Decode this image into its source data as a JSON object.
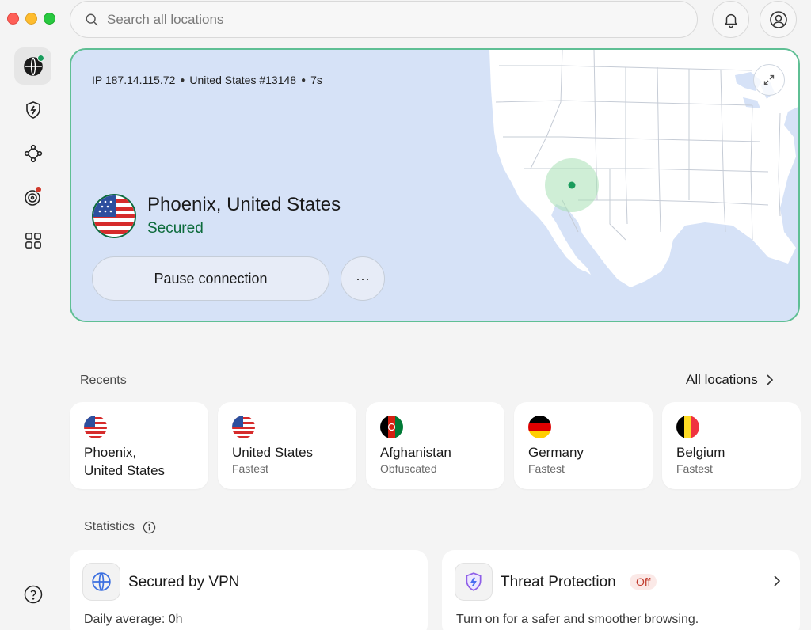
{
  "window": {
    "search_placeholder": "Search all locations"
  },
  "connection": {
    "ip": "IP 187.14.115.72",
    "server": "United States #13148",
    "duration": "7s",
    "location": "Phoenix, United States",
    "status": "Secured",
    "pause_label": "Pause connection",
    "more_label": "···"
  },
  "recents": {
    "title": "Recents",
    "all_locations": "All locations",
    "items": [
      {
        "name": "Phoenix,",
        "name2": "United States",
        "sub": "",
        "flag": "us"
      },
      {
        "name": "United States",
        "sub": "Fastest",
        "flag": "us"
      },
      {
        "name": "Afghanistan",
        "sub": "Obfuscated",
        "flag": "af"
      },
      {
        "name": "Germany",
        "sub": "Fastest",
        "flag": "de"
      },
      {
        "name": "Belgium",
        "sub": "Fastest",
        "flag": "be"
      }
    ]
  },
  "statistics": {
    "title": "Statistics",
    "vpn": {
      "title": "Secured by VPN",
      "sub": "Daily average: 0h"
    },
    "threat": {
      "title": "Threat Protection",
      "badge": "Off",
      "sub": "Turn on for a safer and smoother browsing."
    }
  },
  "colors": {
    "accent_green": "#0d6b3c",
    "map_border": "#5fbf94",
    "alert_red": "#c0392b"
  }
}
